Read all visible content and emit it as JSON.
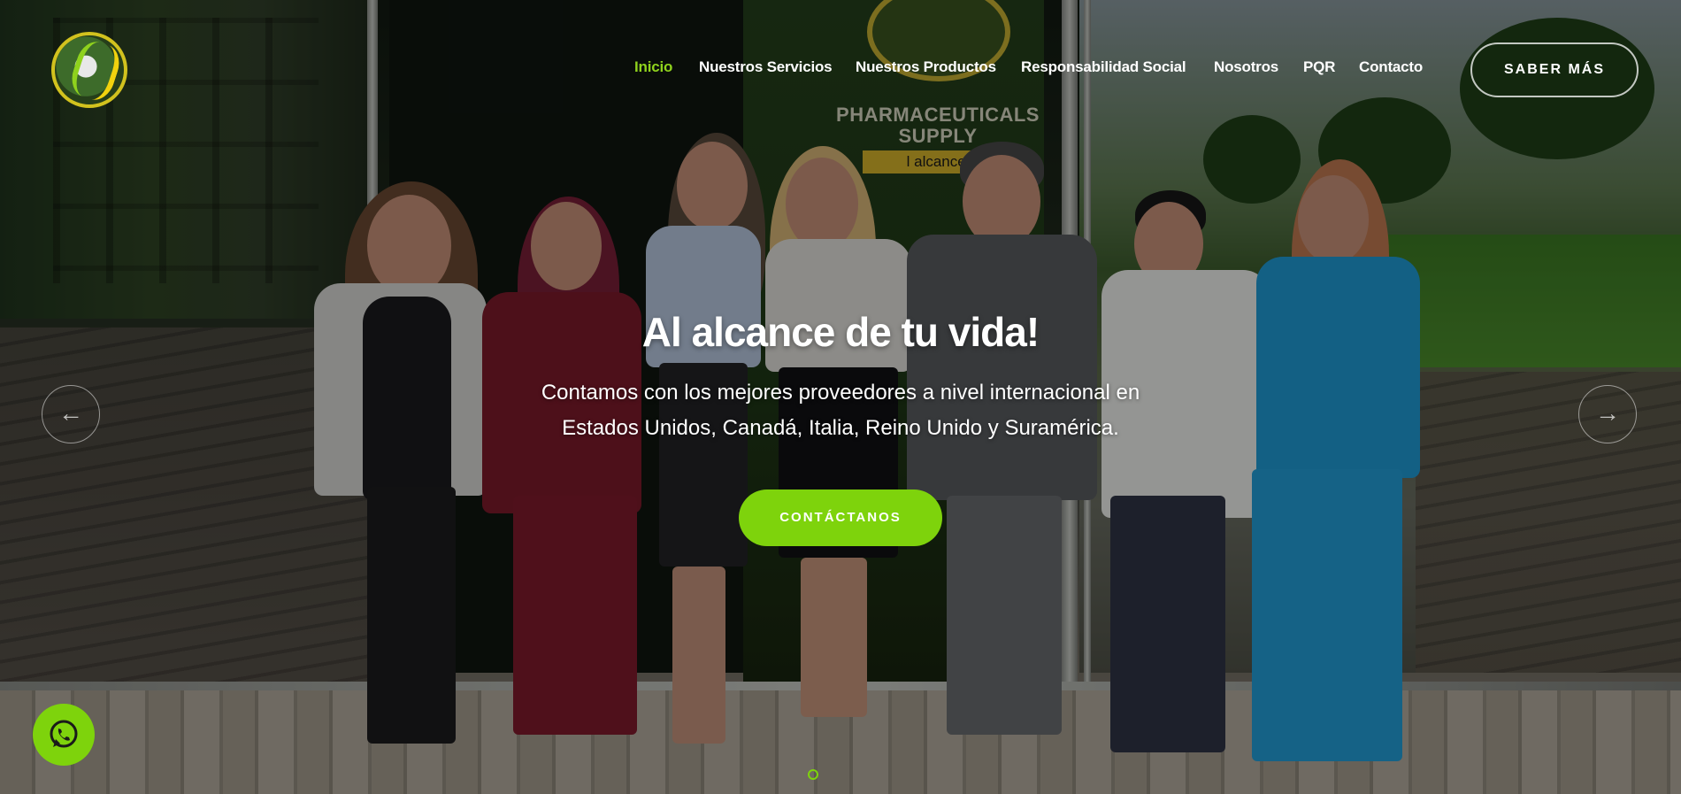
{
  "header": {
    "logo_icon": "pharmaceuticals-supply-dna-logo",
    "nav": [
      {
        "label": "Inicio",
        "active": true
      },
      {
        "label": "Nuestros Servicios",
        "active": false
      },
      {
        "label": "Nuestros Productos",
        "active": false
      },
      {
        "label": "Responsabilidad Social",
        "active": false
      },
      {
        "label": "Nosotros",
        "active": false
      },
      {
        "label": "PQR",
        "active": false
      },
      {
        "label": "Contacto",
        "active": false
      }
    ],
    "cta_label": "SABER MÁS"
  },
  "hero": {
    "headline": "Al alcance de tu vida!",
    "subtext_line1": "Contamos con los mejores proveedores a nivel internacional en",
    "subtext_line2": "Estados Unidos, Canadá, Italia, Reino Unido y Suramérica.",
    "button_label": "CONTÁCTANOS",
    "prev_icon": "arrow-left-icon",
    "next_icon": "arrow-right-icon",
    "background_sign_line1": "PHARMACEUTICALS",
    "background_sign_line2": "SUPPLY",
    "background_sign_band": "l alcance de"
  },
  "whatsapp": {
    "icon": "whatsapp-icon"
  },
  "colors": {
    "accent": "#7ed30c",
    "active_nav": "#8fd21d",
    "text": "#ffffff"
  }
}
